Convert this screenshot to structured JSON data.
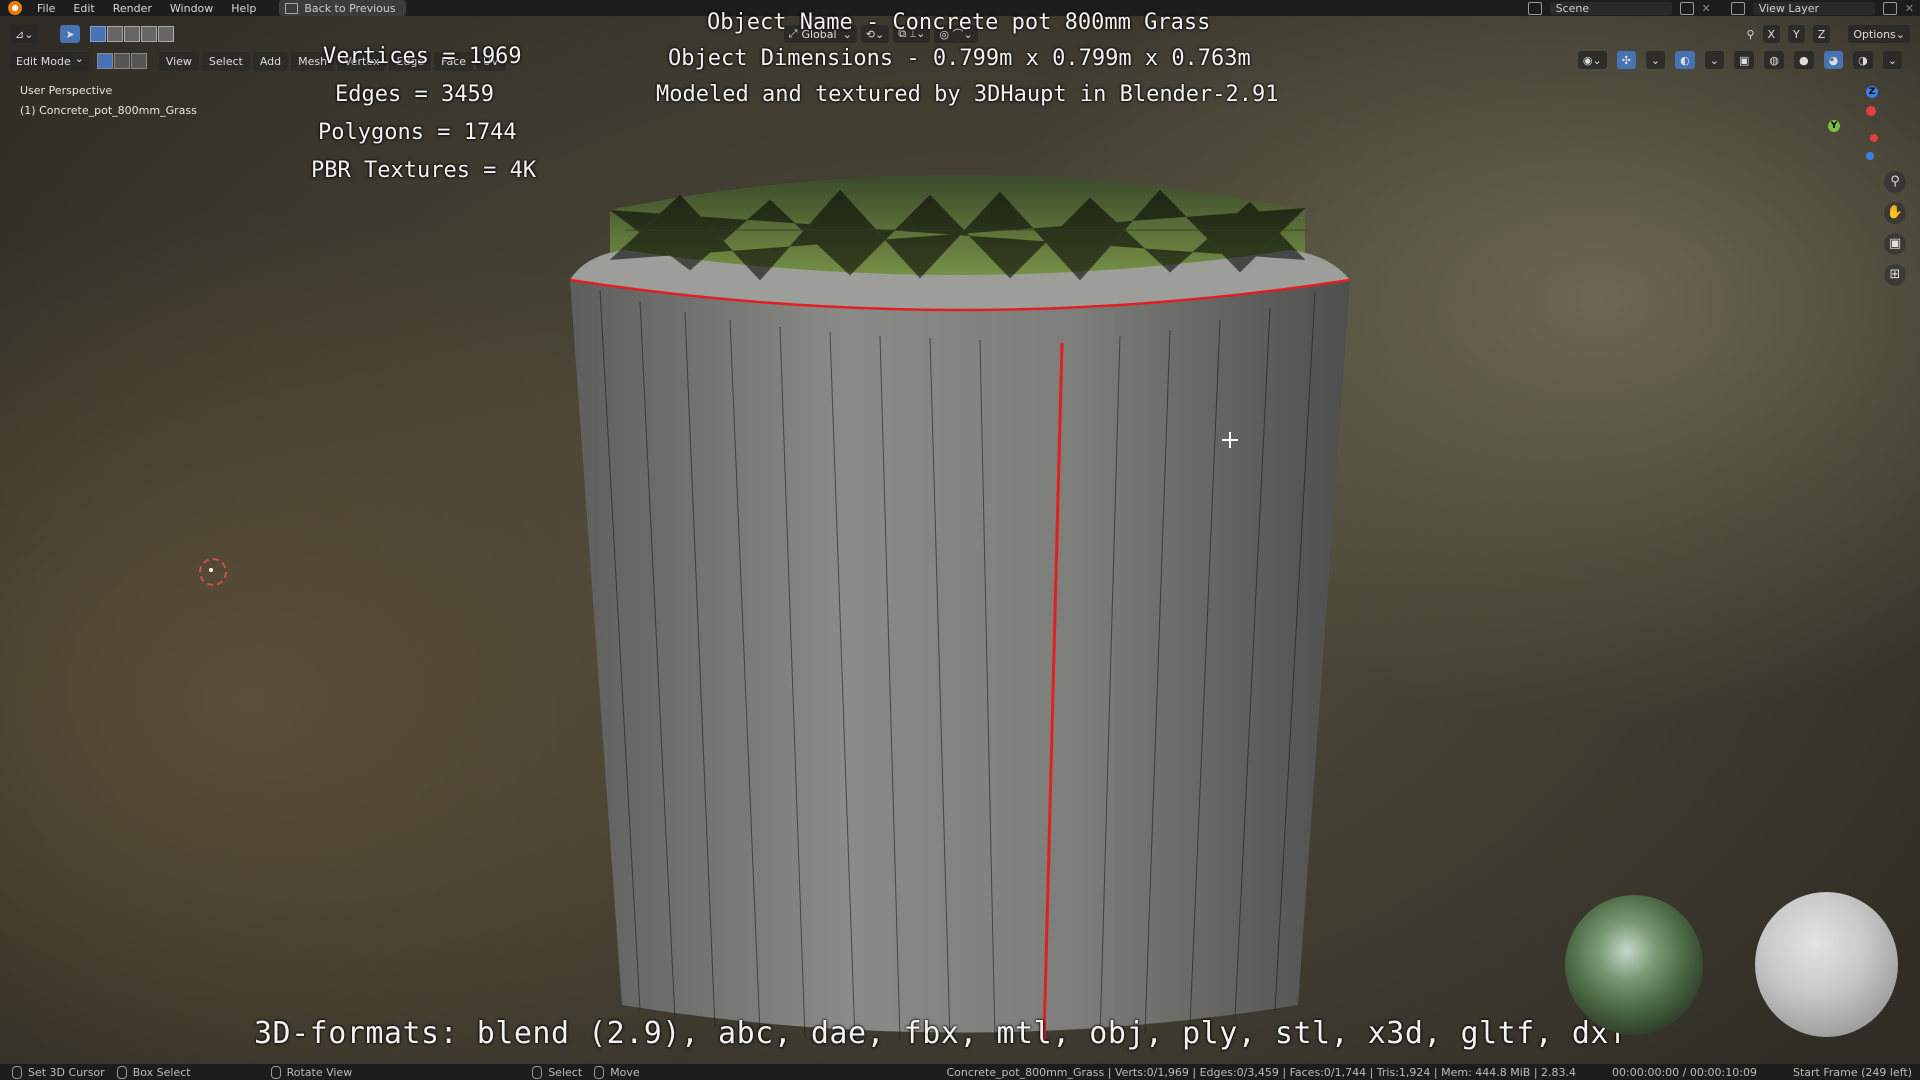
{
  "menu": {
    "file": "File",
    "edit": "Edit",
    "render": "Render",
    "window": "Window",
    "help": "Help",
    "back": "Back to Previous"
  },
  "topright": {
    "scene": "Scene",
    "view_layer": "View Layer",
    "options": "Options"
  },
  "header": {
    "mode": "Edit Mode",
    "view": "View",
    "select": "Select",
    "add": "Add",
    "mesh": "Mesh",
    "vertex": "Vertex",
    "edge": "Edge",
    "face": "Face",
    "uv": "UV",
    "orientation": "Global",
    "axes": [
      "X",
      "Y",
      "Z"
    ]
  },
  "viewport": {
    "perspective": "User Perspective",
    "object": "(1) Concrete_pot_800mm_Grass"
  },
  "overlay": {
    "vertices": "Vertices = 1969",
    "edges": "Edges = 3459",
    "polygons": "Polygons = 1744",
    "textures": "PBR Textures = 4K",
    "object_name": "Object Name - Concrete pot 800mm Grass",
    "dimensions": "Object Dimensions -  0.799m x 0.799m x 0.763m",
    "credit": "Modeled and textured by 3DHaupt in Blender-2.91",
    "formats": "3D-formats: blend (2.9), abc, dae, fbx, mtl, obj, ply, stl, x3d, gltf, dxf"
  },
  "gizmo": {
    "z": "Z",
    "y": "Y"
  },
  "status": {
    "set_cursor": "Set 3D Cursor",
    "box_select": "Box Select",
    "rotate": "Rotate View",
    "select": "Select",
    "move": "Move",
    "info": "Concrete_pot_800mm_Grass | Verts:0/1,969 | Edges:0/3,459 | Faces:0/1,744 | Tris:1,924 | Mem: 444.8 MiB | 2.83.4",
    "time": "00:00:00:00 / 00:00:10:09",
    "frame": "Start Frame (249 left)"
  },
  "colors": {
    "accent": "#4772b3",
    "seam": "#e02020",
    "topbar": "#1d1d1d"
  }
}
